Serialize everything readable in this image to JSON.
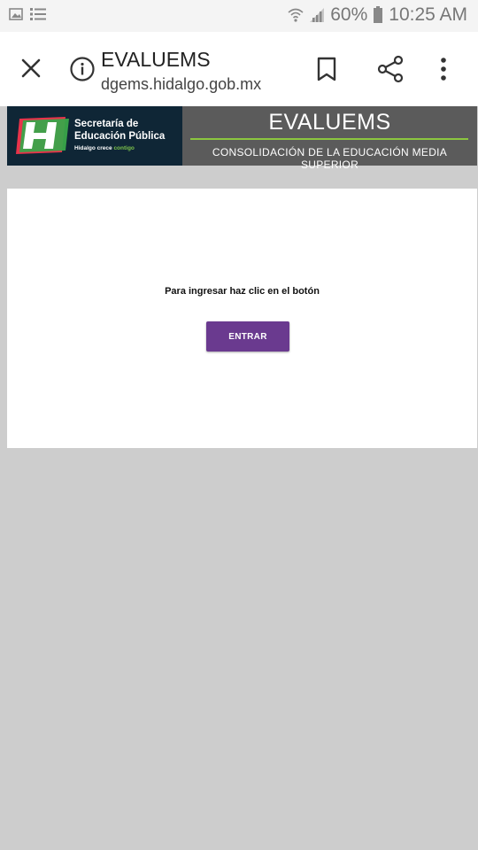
{
  "status_bar": {
    "battery": "60%",
    "time": "10:25 AM",
    "icons": [
      "image-icon",
      "list-icon",
      "wifi-icon",
      "signal-icon",
      "battery-icon"
    ]
  },
  "browser": {
    "title": "EVALUEMS",
    "url": "dgems.hidalgo.gob.mx",
    "icons": [
      "close-icon",
      "info-icon",
      "bookmark-icon",
      "share-icon",
      "more-vert-icon"
    ]
  },
  "banner": {
    "org_line1": "Secretaría de",
    "org_line2": "Educación Pública",
    "tagline_prefix": "Hidalgo crece ",
    "tagline_highlight": "contigo",
    "title": "EVALUEMS",
    "subtitle": "CONSOLIDACIÓN DE LA EDUCACIÓN MEDIA SUPERIOR",
    "colors": {
      "left_bg": "#0f2636",
      "right_bg": "#5b5b5b",
      "accent": "#8cc63f"
    }
  },
  "main": {
    "instruction": "Para ingresar haz clic en el botón",
    "enter_label": "ENTRAR",
    "button_color": "#6a3a8f"
  }
}
